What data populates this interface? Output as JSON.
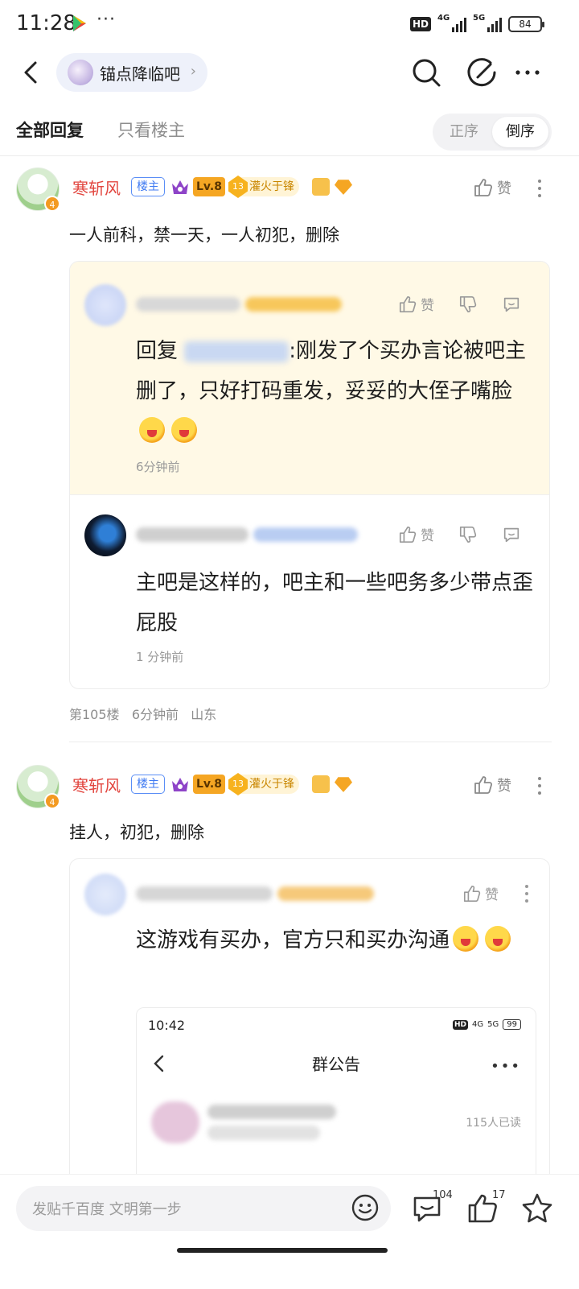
{
  "status_bar": {
    "time": "11:28",
    "more": "···",
    "hd": "HD",
    "net1": "4G",
    "net2": "5G",
    "battery": "84"
  },
  "nav": {
    "forum_name": "锚点降临吧",
    "chevron": "›"
  },
  "tabs": {
    "all_replies": "全部回复",
    "owner_only": "只看楼主",
    "sort_asc": "正序",
    "sort_desc": "倒序"
  },
  "posts": [
    {
      "author": "寒斩风",
      "owner_tag": "楼主",
      "level": "Lv.8",
      "title_num": "13",
      "title_text": "灌火于锋",
      "avatar_badge": "4",
      "like_label": "赞",
      "content": "一人前科，禁一天，一人初犯，删除",
      "replies": [
        {
          "prefix": "回复",
          "text": ":刚发了个买办言论被吧主删了，只好打码重发，妥妥的大侄子嘴脸",
          "time": "6分钟前",
          "like_label": "赞"
        },
        {
          "text": "主吧是这样的，吧主和一些吧务多少带点歪屁股",
          "time": "1 分钟前",
          "like_label": "赞"
        }
      ],
      "floor": "第105楼",
      "time": "6分钟前",
      "location": "山东"
    },
    {
      "author": "寒斩风",
      "owner_tag": "楼主",
      "level": "Lv.8",
      "title_num": "13",
      "title_text": "灌火于锋",
      "avatar_badge": "4",
      "like_label": "赞",
      "content": "挂人，初犯，删除",
      "replies": [
        {
          "text": "这游戏有买办，官方只和买办沟通",
          "like_label": "赞",
          "embed": {
            "time": "10:42",
            "hd": "HD",
            "net1": "4G",
            "net2": "5G",
            "battery": "99",
            "title": "群公告",
            "more": "•••",
            "read_count": "115人已读"
          }
        }
      ]
    }
  ],
  "bottom": {
    "placeholder": "发贴千百度 文明第一步",
    "comment_count": "104",
    "like_count": "17"
  },
  "colors": {
    "username": "#e2463f",
    "owner_tag": "#3f7af2",
    "level_badge": "#f5a623",
    "highlight_reply_bg": "#fff9e6"
  }
}
